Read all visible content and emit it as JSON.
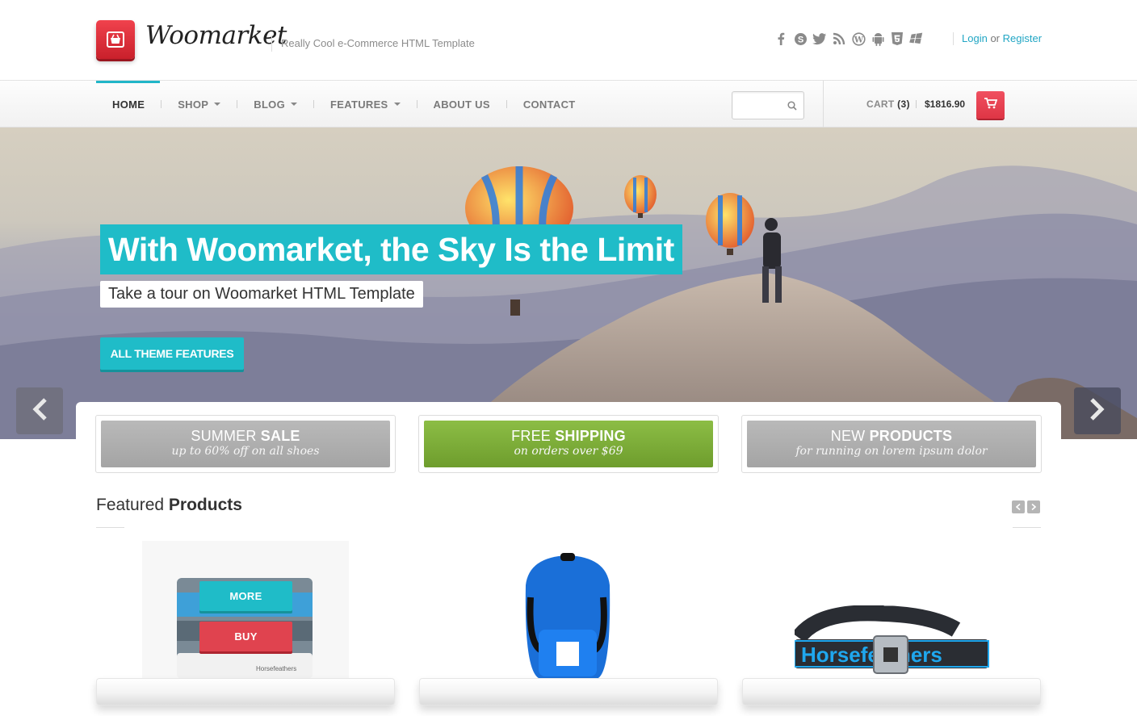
{
  "brand": {
    "name": "Woomarket",
    "tagline": "Really Cool e-Commerce HTML Template"
  },
  "social_icons": [
    "facebook-icon",
    "skype-icon",
    "twitter-icon",
    "rss-icon",
    "wordpress-icon",
    "android-icon",
    "html5-icon",
    "windows-icon"
  ],
  "auth": {
    "login": "Login",
    "or": "or",
    "register": "Register"
  },
  "nav": {
    "items": [
      {
        "label": "HOME",
        "active": true,
        "dropdown": false
      },
      {
        "label": "SHOP",
        "active": false,
        "dropdown": true
      },
      {
        "label": "BLOG",
        "active": false,
        "dropdown": true
      },
      {
        "label": "FEATURES",
        "active": false,
        "dropdown": true
      },
      {
        "label": "ABOUT US",
        "active": false,
        "dropdown": false
      },
      {
        "label": "CONTACT",
        "active": false,
        "dropdown": false
      }
    ],
    "search_placeholder": ""
  },
  "cart": {
    "label": "CART",
    "count": "(3)",
    "total": "$1816.90"
  },
  "hero": {
    "title": "With Woomarket, the Sky Is the Limit",
    "subtitle": "Take a tour on Woomarket HTML Template",
    "button": "ALL THEME FEATURES"
  },
  "promos": [
    {
      "title_light": "SUMMER",
      "title_bold": "SALE",
      "subtitle": "up to 60% off on all shoes",
      "style": "gray"
    },
    {
      "title_light": "FREE",
      "title_bold": "SHIPPING",
      "subtitle": "on orders over $69",
      "style": "green"
    },
    {
      "title_light": "NEW",
      "title_bold": "PRODUCTS",
      "subtitle": "for running on lorem ipsum dolor",
      "style": "gray"
    }
  ],
  "featured": {
    "title_light": "Featured",
    "title_bold": "Products"
  },
  "product_actions": {
    "more": "MORE",
    "buy": "BUY"
  },
  "product_brand_label": "Horsefeathers",
  "colors": {
    "accent": "#1fbcc8",
    "buy": "#e0434f",
    "shipping_green": "#7aab35",
    "link": "#21a6c4"
  }
}
